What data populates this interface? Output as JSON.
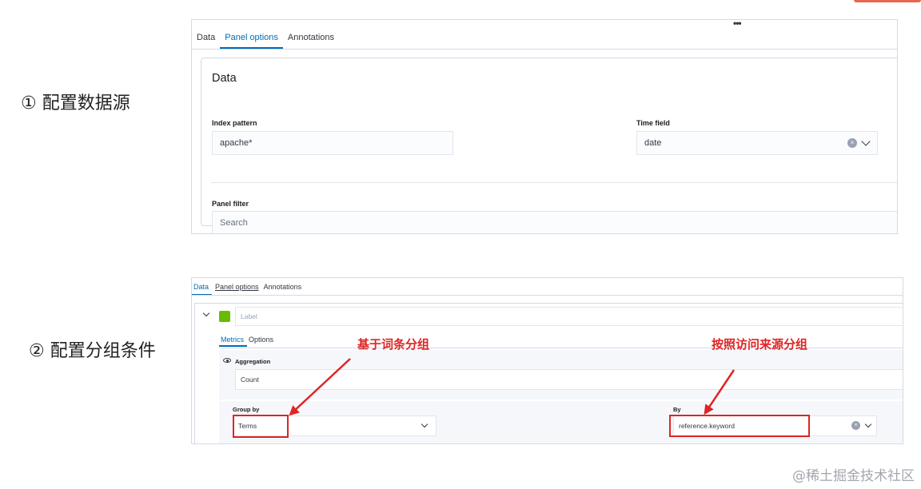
{
  "steps": {
    "step1": "① 配置数据源",
    "step2": "② 配置分组条件"
  },
  "panel1": {
    "menu_icon": "more-dots-icon",
    "tabs": [
      "Data",
      "Panel options",
      "Annotations"
    ],
    "active_tab": "Panel options",
    "section_title": "Data",
    "index_pattern_label": "Index pattern",
    "index_pattern_value": "apache*",
    "time_field_label": "Time field",
    "time_field_value": "date",
    "panel_filter_label": "Panel filter",
    "panel_filter_placeholder": "Search"
  },
  "panel2": {
    "tabs": [
      "Data",
      "Panel options",
      "Annotations"
    ],
    "active_tab": "Data",
    "series_label_placeholder": "Label",
    "series_color": "#68bc00",
    "subtabs": [
      "Metrics",
      "Options"
    ],
    "active_subtab": "Metrics",
    "aggregation_label": "Aggregation",
    "aggregation_value": "Count",
    "group_by_label": "Group by",
    "group_by_value": "Terms",
    "by_label": "By",
    "by_value": "reference.keyword"
  },
  "annotations": {
    "left": "基于词条分组",
    "right": "按照访问来源分组",
    "color": "#e02424"
  },
  "watermark": "@稀土掘金技术社区"
}
